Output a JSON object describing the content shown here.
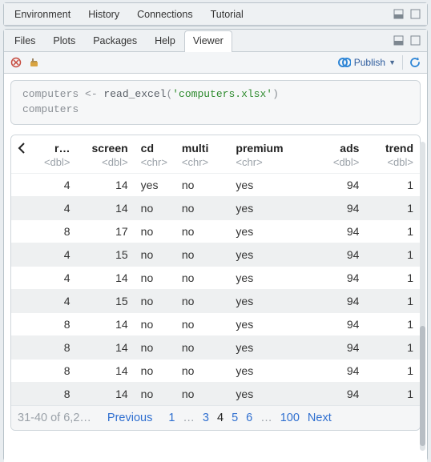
{
  "topPane": {
    "tabs": [
      {
        "label": "Environment"
      },
      {
        "label": "History"
      },
      {
        "label": "Connections"
      },
      {
        "label": "Tutorial"
      }
    ]
  },
  "bottomPane": {
    "tabs": [
      {
        "label": "Files"
      },
      {
        "label": "Plots"
      },
      {
        "label": "Packages"
      },
      {
        "label": "Help"
      },
      {
        "label": "Viewer"
      }
    ],
    "activeTabIndex": 4,
    "publishLabel": "Publish"
  },
  "code": {
    "line1_lhs": "computers ",
    "line1_assign": "<- ",
    "line1_fn": "read_excel",
    "line1_open": "(",
    "line1_str": "'computers.xlsx'",
    "line1_close": ")",
    "line2": "computers"
  },
  "table": {
    "columns": [
      {
        "label": "r…",
        "type": "<dbl>",
        "align": "num"
      },
      {
        "label": "screen",
        "type": "<dbl>",
        "align": "num"
      },
      {
        "label": "cd",
        "type": "<chr>",
        "align": "chr"
      },
      {
        "label": "multi",
        "type": "<chr>",
        "align": "chr"
      },
      {
        "label": "premium",
        "type": "<chr>",
        "align": "chr"
      },
      {
        "label": "ads",
        "type": "<dbl>",
        "align": "num"
      },
      {
        "label": "trend",
        "type": "<dbl>",
        "align": "num"
      }
    ],
    "rows": [
      [
        "4",
        "14",
        "yes",
        "no",
        "yes",
        "94",
        "1"
      ],
      [
        "4",
        "14",
        "no",
        "no",
        "yes",
        "94",
        "1"
      ],
      [
        "8",
        "17",
        "no",
        "no",
        "yes",
        "94",
        "1"
      ],
      [
        "4",
        "15",
        "no",
        "no",
        "yes",
        "94",
        "1"
      ],
      [
        "4",
        "14",
        "no",
        "no",
        "yes",
        "94",
        "1"
      ],
      [
        "4",
        "15",
        "no",
        "no",
        "yes",
        "94",
        "1"
      ],
      [
        "8",
        "14",
        "no",
        "no",
        "yes",
        "94",
        "1"
      ],
      [
        "8",
        "14",
        "no",
        "no",
        "yes",
        "94",
        "1"
      ],
      [
        "8",
        "14",
        "no",
        "no",
        "yes",
        "94",
        "1"
      ],
      [
        "8",
        "14",
        "no",
        "no",
        "yes",
        "94",
        "1"
      ]
    ],
    "pager": {
      "summary": "31-40 of 6,2…",
      "prev": "Previous",
      "pages": [
        {
          "n": "1",
          "kind": "link"
        },
        {
          "n": "…",
          "kind": "dots"
        },
        {
          "n": "3",
          "kind": "link"
        },
        {
          "n": "4",
          "kind": "current"
        },
        {
          "n": "5",
          "kind": "link"
        },
        {
          "n": "6",
          "kind": "link"
        },
        {
          "n": "…",
          "kind": "dots"
        },
        {
          "n": "100",
          "kind": "link"
        }
      ],
      "next": "Next"
    }
  }
}
